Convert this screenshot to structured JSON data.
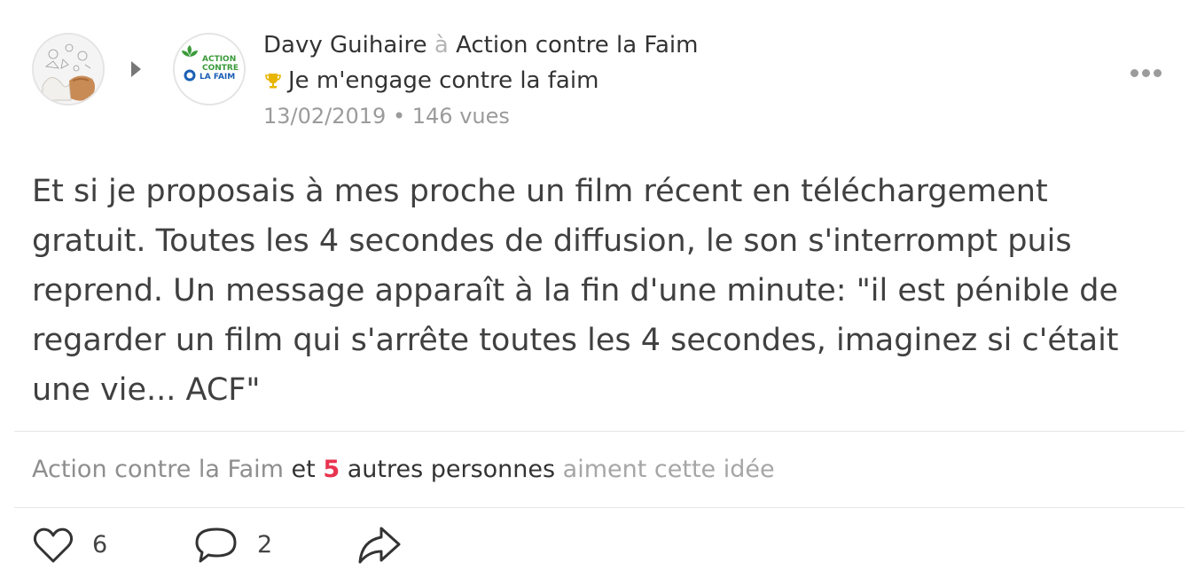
{
  "post": {
    "author": "Davy Guihaire",
    "separator": "à",
    "target": "Action contre la Faim",
    "campaign": "Je m'engage contre la faim",
    "date": "13/02/2019",
    "meta_separator": "•",
    "views": "146 vues",
    "body": "Et si je proposais à mes proche un film récent en téléchargement gratuit. Toutes les 4 secondes de diffusion, le son s'interrompt puis reprend. Un message apparaît à la fin d'une minute: \"il est pénible de regarder un film qui s'arrête toutes les 4 secondes, imaginez si c'était une vie... ACF\""
  },
  "org_logo": {
    "line1": "ACTION",
    "line2": "CONTRE",
    "line3": "LA FAIM"
  },
  "likes": {
    "org": "Action contre la Faim",
    "conj": "et",
    "count": "5",
    "others": "autres personnes",
    "tail": "aiment cette idée"
  },
  "actions": {
    "like_count": "6",
    "comment_count": "2"
  },
  "colors": {
    "accent_count": "#e8334f",
    "muted": "#9b9b9b",
    "trophy": "#e8b500",
    "logo_green": "#3a9a3a",
    "logo_blue": "#1a5fb4"
  },
  "icons": [
    "user-avatar",
    "arrow-right-icon",
    "org-logo",
    "trophy-icon",
    "more-icon",
    "heart-icon",
    "comment-icon",
    "share-icon"
  ]
}
